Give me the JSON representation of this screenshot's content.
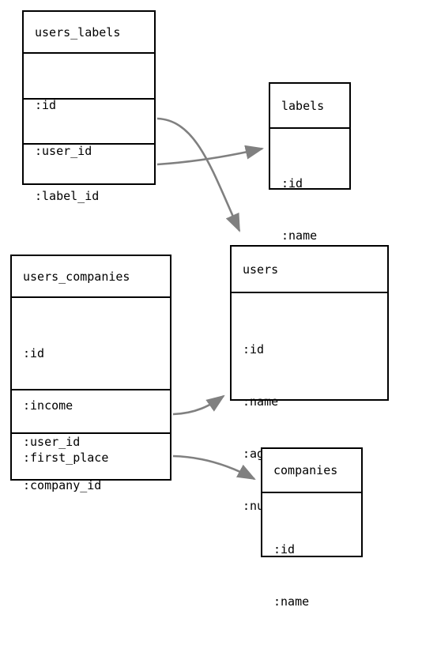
{
  "diagram": {
    "type": "entity-relationship-diagram",
    "background_color": "#ffffff",
    "box_border_color": "#000000",
    "text_color": "#000000",
    "edge_color": "#808080",
    "entities": [
      {
        "id": "users_labels",
        "name": "users_labels",
        "sections": [
          {
            "fields": [
              ":id"
            ]
          },
          {
            "fields": [
              ":user_id"
            ]
          },
          {
            "fields": [
              ":label_id"
            ]
          }
        ]
      },
      {
        "id": "labels",
        "name": "labels",
        "sections": [
          {
            "fields": [
              ":id",
              ":name"
            ]
          }
        ]
      },
      {
        "id": "users",
        "name": "users",
        "sections": [
          {
            "fields": [
              ":id",
              ":name",
              ":age",
              ":num_nomination"
            ]
          }
        ]
      },
      {
        "id": "users_companies",
        "name": "users_companies",
        "sections": [
          {
            "fields": [
              ":id",
              ":income",
              ":first_place"
            ]
          },
          {
            "fields": [
              ":user_id"
            ]
          },
          {
            "fields": [
              ":company_id"
            ]
          }
        ]
      },
      {
        "id": "companies",
        "name": "companies",
        "sections": [
          {
            "fields": [
              ":id",
              ":name"
            ]
          }
        ]
      }
    ],
    "relationships": [
      {
        "id": "users_labels-user_id-to-users",
        "from": "users_labels.:user_id",
        "to": "users",
        "arrow": "single"
      },
      {
        "id": "users_labels-label_id-to-labels",
        "from": "users_labels.:label_id",
        "to": "labels",
        "arrow": "single"
      },
      {
        "id": "users_companies-user_id-to-users",
        "from": "users_companies.:user_id",
        "to": "users",
        "arrow": "single"
      },
      {
        "id": "users_companies-company_id-to-companies",
        "from": "users_companies.:company_id",
        "to": "companies",
        "arrow": "single"
      }
    ]
  }
}
